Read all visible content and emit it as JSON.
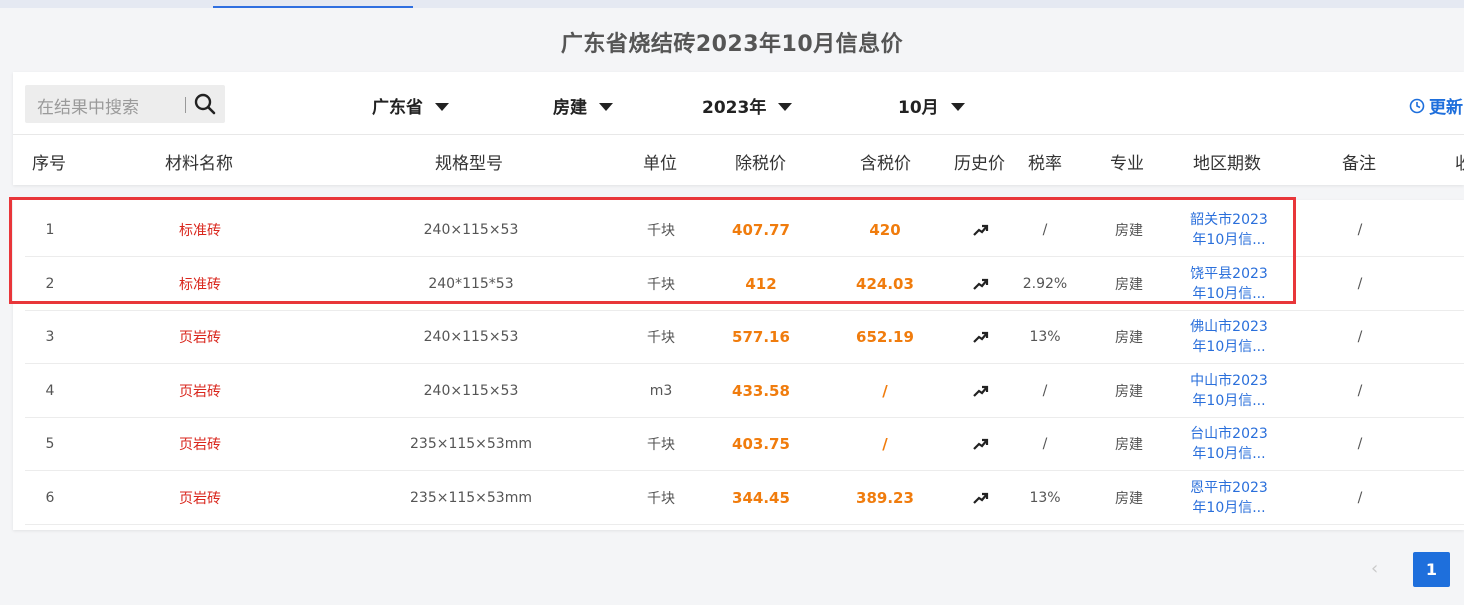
{
  "page": {
    "title": "广东省烧结砖2023年10月信息价"
  },
  "search": {
    "placeholder": "在结果中搜索"
  },
  "filters": {
    "province": "广东省",
    "category": "房建",
    "year": "2023年",
    "month": "10月"
  },
  "update_label": "更新",
  "columns": [
    "序号",
    "材料名称",
    "规格型号",
    "单位",
    "除税价",
    "含税价",
    "历史价",
    "税率",
    "专业",
    "地区期数",
    "备注",
    "收"
  ],
  "rows": [
    {
      "no": "1",
      "name": "标准砖",
      "spec": "240×115×53",
      "unit": "千块",
      "price_ex": "407.77",
      "price_in": "420",
      "tax": "/",
      "major": "房建",
      "region1": "韶关市2023",
      "region2": "年10月信...",
      "note": "/"
    },
    {
      "no": "2",
      "name": "标准砖",
      "spec": "240*115*53",
      "unit": "千块",
      "price_ex": "412",
      "price_in": "424.03",
      "tax": "2.92%",
      "major": "房建",
      "region1": "饶平县2023",
      "region2": "年10月信...",
      "note": "/"
    },
    {
      "no": "3",
      "name": "页岩砖",
      "spec": "240×115×53",
      "unit": "千块",
      "price_ex": "577.16",
      "price_in": "652.19",
      "tax": "13%",
      "major": "房建",
      "region1": "佛山市2023",
      "region2": "年10月信...",
      "note": "/"
    },
    {
      "no": "4",
      "name": "页岩砖",
      "spec": "240×115×53",
      "unit": "m3",
      "price_ex": "433.58",
      "price_in": "/",
      "tax": "/",
      "major": "房建",
      "region1": "中山市2023",
      "region2": "年10月信...",
      "note": "/"
    },
    {
      "no": "5",
      "name": "页岩砖",
      "spec": "235×115×53mm",
      "unit": "千块",
      "price_ex": "403.75",
      "price_in": "/",
      "tax": "/",
      "major": "房建",
      "region1": "台山市2023",
      "region2": "年10月信...",
      "note": "/"
    },
    {
      "no": "6",
      "name": "页岩砖",
      "spec": "235×115×53mm",
      "unit": "千块",
      "price_ex": "344.45",
      "price_in": "389.23",
      "tax": "13%",
      "major": "房建",
      "region1": "恩平市2023",
      "region2": "年10月信...",
      "note": "/"
    }
  ],
  "pagination": {
    "prev": "‹",
    "current": "1"
  },
  "colors": {
    "accent": "#1e6fdc",
    "name": "#d9261c",
    "price": "#f07c0d",
    "highlight": "#e8363a"
  },
  "icons": {
    "search": "search-icon",
    "clock": "clock-icon",
    "trend": "trend-up-icon",
    "dropdown": "caret-down-icon"
  }
}
